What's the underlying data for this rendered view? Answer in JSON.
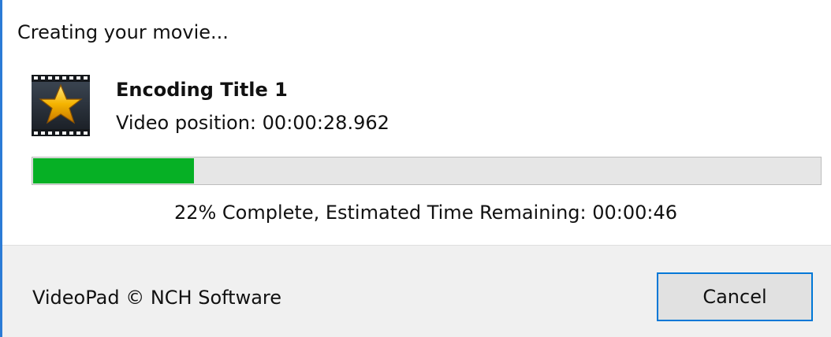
{
  "dialog": {
    "header": "Creating your movie..."
  },
  "job": {
    "icon": "videopad-filmstrip-star-icon",
    "title": "Encoding Title 1",
    "position_text": "Video position:  00:00:28.962"
  },
  "progress": {
    "percent": 22,
    "status_text": "22% Complete, Estimated Time Remaining: 00:00:46",
    "fill_color": "#06b025"
  },
  "footer": {
    "copyright": "VideoPad © NCH Software",
    "cancel_label": "Cancel"
  },
  "colors": {
    "accent": "#0078d7",
    "progress_green": "#06b025"
  }
}
